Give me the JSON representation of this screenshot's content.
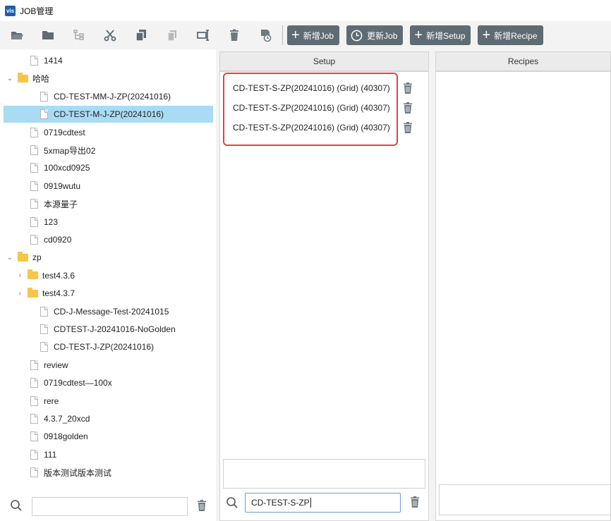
{
  "window": {
    "logo": "vis",
    "title": "JOB管理"
  },
  "toolbar": {
    "icons": [
      "open-folder-icon",
      "folder-icon",
      "tree-structure-icon",
      "cut-icon",
      "copy-icon",
      "paste-icon",
      "rename-icon",
      "delete-icon",
      "history-icon"
    ],
    "buttons": {
      "new_job": "新增Job",
      "update_job": "更新Job",
      "new_setup": "新增Setup",
      "new_recipe": "新增Recipe"
    },
    "accent": "#5f6b73"
  },
  "tree": {
    "items": [
      {
        "label": "1414",
        "type": "file"
      },
      {
        "label": "哈哈",
        "type": "folder",
        "expanded": true
      },
      {
        "label": "CD-TEST-MM-J-ZP(20241016)",
        "type": "file"
      },
      {
        "label": "CD-TEST-M-J-ZP(20241016)",
        "type": "file",
        "selected": true
      },
      {
        "label": "0719cdtest",
        "type": "file"
      },
      {
        "label": "5xmap导出02",
        "type": "file"
      },
      {
        "label": "100xcd0925",
        "type": "file"
      },
      {
        "label": "0919wutu",
        "type": "file"
      },
      {
        "label": "本源量子",
        "type": "file"
      },
      {
        "label": "123",
        "type": "file"
      },
      {
        "label": "cd0920",
        "type": "file"
      },
      {
        "label": "zp",
        "type": "folder",
        "expanded": true
      },
      {
        "label": "test4.3.6",
        "type": "folder",
        "expanded": false
      },
      {
        "label": "test4.3.7",
        "type": "folder",
        "expanded": false
      },
      {
        "label": "CD-J-Message-Test-20241015",
        "type": "file"
      },
      {
        "label": "CDTEST-J-20241016-NoGolden",
        "type": "file"
      },
      {
        "label": "CD-TEST-J-ZP(20241016)",
        "type": "file"
      },
      {
        "label": "review",
        "type": "file"
      },
      {
        "label": "0719cdtest—100x",
        "type": "file"
      },
      {
        "label": "rere",
        "type": "file"
      },
      {
        "label": "4.3.7_20xcd",
        "type": "file"
      },
      {
        "label": "0918golden",
        "type": "file"
      },
      {
        "label": "111",
        "type": "file"
      },
      {
        "label": "版本测试版本测试",
        "type": "file"
      }
    ],
    "selected_color": "#a9dbf3",
    "search": {
      "value": "",
      "placeholder": ""
    }
  },
  "setup": {
    "header": "Setup",
    "items": [
      "CD-TEST-S-ZP(20241016) (Grid) (40307)",
      "CD-TEST-S-ZP(20241016) (Grid) (40307)",
      "CD-TEST-S-ZP(20241016) (Grid) (40307)"
    ],
    "highlight_color": "#d9473f",
    "search_value": "CD-TEST-S-ZP"
  },
  "recipes": {
    "header": "Recipes",
    "items": []
  }
}
